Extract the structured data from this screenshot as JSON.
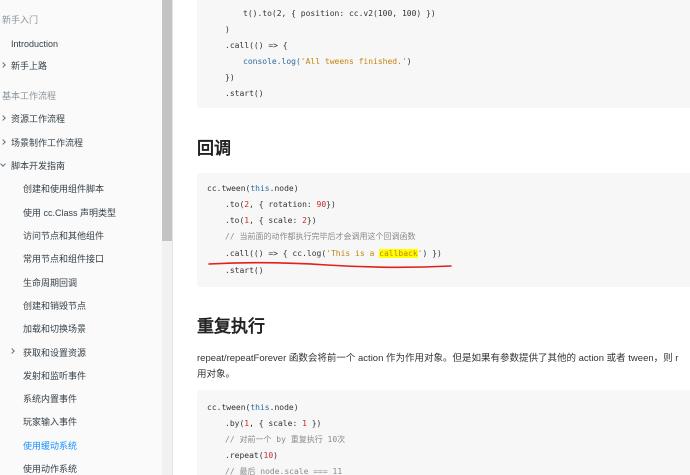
{
  "sidebar": {
    "items": [
      {
        "label": "新手入门",
        "kind": "header"
      },
      {
        "label": "Introduction",
        "kind": "item"
      },
      {
        "label": "新手上路",
        "kind": "expandable"
      },
      {
        "label": "基本工作流程",
        "kind": "header"
      },
      {
        "label": "资源工作流程",
        "kind": "expandable"
      },
      {
        "label": "场景制作工作流程",
        "kind": "expandable"
      },
      {
        "label": "脚本开发指南",
        "kind": "expanded"
      },
      {
        "label": "创建和使用组件脚本",
        "kind": "sub"
      },
      {
        "label": "使用 cc.Class 声明类型",
        "kind": "sub"
      },
      {
        "label": "访问节点和其他组件",
        "kind": "sub"
      },
      {
        "label": "常用节点和组件接口",
        "kind": "sub"
      },
      {
        "label": "生命周期回调",
        "kind": "sub"
      },
      {
        "label": "创建和销毁节点",
        "kind": "sub"
      },
      {
        "label": "加载和切换场景",
        "kind": "sub"
      },
      {
        "label": "获取和设置资源",
        "kind": "sub-expandable"
      },
      {
        "label": "发射和监听事件",
        "kind": "sub"
      },
      {
        "label": "系统内置事件",
        "kind": "sub"
      },
      {
        "label": "玩家输入事件",
        "kind": "sub"
      },
      {
        "label": "使用缓动系统",
        "kind": "active"
      },
      {
        "label": "使用动作系统",
        "kind": "sub"
      }
    ]
  },
  "content": {
    "code1": {
      "l0": "t().to(2, { position: cc.v2(100, 100) })",
      "l1": ")",
      "l2": ".call(() => {",
      "l3a": "console.log(",
      "l3b": "'All tweens finished.'",
      "l3c": ")",
      "l4": "})",
      "l5": ".start()"
    },
    "heading_callback": "回调",
    "code2": {
      "l0a": "cc.tween(",
      "l0b": "this",
      "l0c": ".node)",
      "l1a": ".to(",
      "l1b": "2",
      "l1c": ", { rotation: ",
      "l1d": "90",
      "l1e": "})",
      "l2a": ".to(",
      "l2b": "1",
      "l2c": ", { scale: ",
      "l2d": "2",
      "l2e": "})",
      "l3": "// 当前面的动作都执行完毕后才会调用这个回调函数",
      "l4a": ".call(() => { cc.log(",
      "l4b": "'This is a ",
      "l4c": "callback",
      "l4d": "'",
      "l4e": ") })",
      "l5": ".start()"
    },
    "heading_repeat": "重复执行",
    "repeat_para_line1": "repeat/repeatForever 函数会将前一个 action 作为作用对象。但是如果有参数提供了其他的 action 或者 tween，则 r",
    "repeat_para_line2": "用对象。",
    "code3": {
      "l0a": "cc.tween(",
      "l0b": "this",
      "l0c": ".node)",
      "l1a": ".by(",
      "l1b": "1",
      "l1c": ", { scale: ",
      "l1d": "1",
      "l1e": " })",
      "l2": "// 对前一个 by 重复执行 10次",
      "l3a": ".repeat(",
      "l3b": "10",
      "l3c": ")",
      "l4": "// 最后 node.scale === 11"
    }
  },
  "colors": {
    "active_link": "#1890ff",
    "annotation_red": "#e0201b",
    "highlight": "#ffff00"
  }
}
